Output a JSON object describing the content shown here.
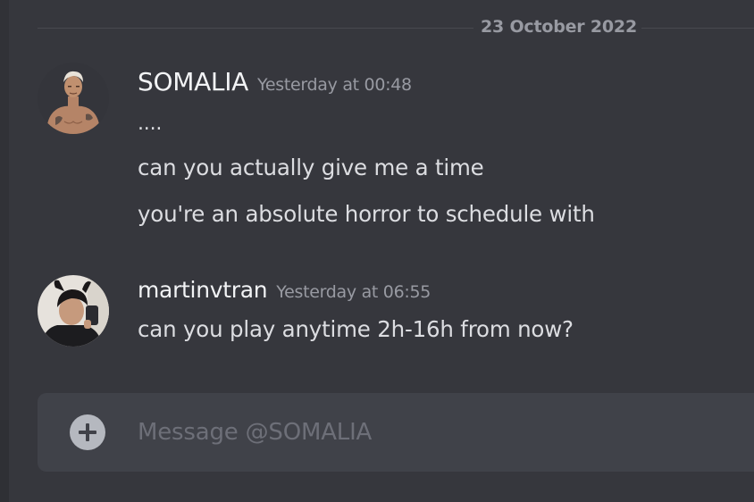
{
  "date_divider": "23 October 2022",
  "messages": [
    {
      "username": "SOMALIA",
      "timestamp": "Yesterday at 00:48",
      "avatar_icon": "fighter-avatar",
      "lines": [
        "....",
        "can you actually give me a time",
        "you're an absolute horror to schedule with"
      ]
    },
    {
      "username": "martinvtran",
      "timestamp": "Yesterday at 06:55",
      "avatar_icon": "selfie-avatar",
      "lines": [
        "can you play anytime 2h-16h from now?"
      ]
    }
  ],
  "composer": {
    "placeholder": "Message @SOMALIA",
    "value": "",
    "add_icon": "plus-circle-icon"
  },
  "colors": {
    "background": "#36373d",
    "composer": "#404249",
    "username": "#f2f3f5",
    "message_text": "#dcdde1",
    "muted": "#989aa2",
    "placeholder": "#6d6f78"
  }
}
